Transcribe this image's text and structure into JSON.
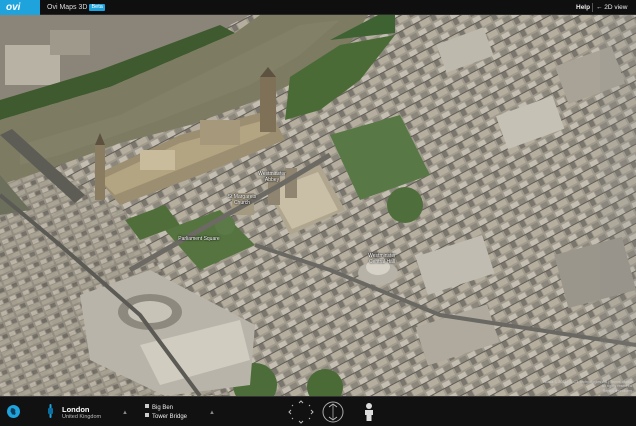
{
  "header": {
    "logo_text": "ovi",
    "app_title": "Ovi Maps 3D",
    "beta_badge": "Beta",
    "help_label": "Help",
    "view_toggle_label": "← 2D view",
    "brand_color": "#1fa3dc"
  },
  "map": {
    "labels": [
      {
        "text": "Westminster Abbey"
      },
      {
        "text": "St Margarets Church"
      },
      {
        "text": "Parliament Square"
      },
      {
        "text": "Westminster Central Hall"
      }
    ],
    "copyright_lines": [
      "Nokia © 2011 | © C3 Technologies AB | Terms of use",
      "All rights reserved",
      "Report a problem"
    ]
  },
  "footer": {
    "globe_icon": "globe-icon",
    "location": {
      "city": "London",
      "country": "United Kingdom"
    },
    "pois": [
      {
        "label": "Big Ben"
      },
      {
        "label": "Tower Bridge"
      }
    ],
    "controls": {
      "pan_icon": "pan-arrows-icon",
      "tilt_icon": "tilt-icon",
      "zoom_icon": "zoom-dial-icon",
      "street_view_icon": "person-icon"
    }
  }
}
